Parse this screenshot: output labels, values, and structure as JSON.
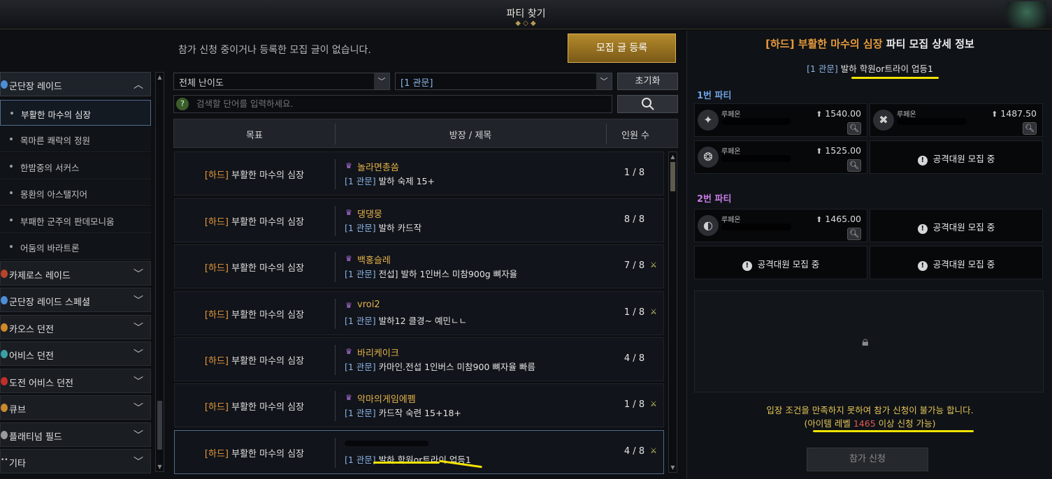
{
  "window": {
    "title": "파티 찾기"
  },
  "top": {
    "notice": "참가 신청 중이거나 등록한 모집 글이 없습니다.",
    "register_button": "모집 글 등록"
  },
  "sidebar": {
    "raid_group": "군단장 레이드",
    "raid_items": [
      "부활한 마수의 심장",
      "목마른 쾌락의 정원",
      "한밤중의 서커스",
      "몽환의 아스탤지어",
      "부패한 군주의 판데모니움",
      "어둠의 바라트론"
    ],
    "categories": [
      "카제로스 레이드",
      "군단장 레이드 스페셜",
      "카오스 던전",
      "어비스 던전",
      "도전 어비스 던전",
      "큐브",
      "플래티넘 필드",
      "기타"
    ]
  },
  "filters": {
    "difficulty": "전체 난이도",
    "gate": "[1 관문]",
    "reset_button": "초기화",
    "search_placeholder": "검색할 단어를 입력하세요.",
    "help_glyph": "?"
  },
  "table": {
    "headers": {
      "goal": "목표",
      "leader_title": "방장 / 제목",
      "count": "인원 수"
    },
    "goal_tag": "[하드]",
    "goal_name": "부활한 마수의 심장",
    "gate_tag": "[1 관문]",
    "rows": [
      {
        "leader": "놀라면총쏨",
        "subject": " 발하 숙제 15+",
        "count": "1 / 8",
        "sword": false
      },
      {
        "leader": "댕댕뭉",
        "subject": " 발하 카드작",
        "count": "8 / 8",
        "sword": false
      },
      {
        "leader": "백홍슬레",
        "subject": " 전섭] 발하 1인버스 미참900g 뼈자율",
        "count": "7 / 8",
        "sword": true
      },
      {
        "leader": "vroi2",
        "subject": " 발하12 클경~ 예민ㄴㄴ",
        "count": "1 / 8",
        "sword": true
      },
      {
        "leader": "바리케이크",
        "subject": " 카마인.전섭 1인버스 미참900 뼈자율 빠름",
        "count": "4 / 8",
        "sword": false
      },
      {
        "leader": "악마의게임에펨",
        "subject": " 카드작 숙련 15+18+",
        "count": "1 / 8",
        "sword": true
      },
      {
        "leader": "",
        "subject": " 발하 학원or트라이 업등1",
        "count": "4 / 8",
        "sword": true
      }
    ]
  },
  "detail": {
    "title_tag": "[하드]",
    "title_name": "부활한 마수의 심장",
    "title_suffix": "파티 모집 상세 정보",
    "subtitle_gate": "[1 관문]",
    "subtitle": " 발하 학원or트라이 업등1",
    "party1_label": "1번 파티",
    "party2_label": "2번 파티",
    "members": [
      {
        "name": "루페온",
        "ilvl": "1540.00"
      },
      {
        "name": "루페온",
        "ilvl": "1487.50"
      },
      {
        "name": "루페온",
        "ilvl": "1525.00"
      },
      {
        "name": "루페온",
        "ilvl": "1465.00"
      }
    ],
    "recruiting": "공격대원 모집 중",
    "warning_line1": "입장 조건을 만족하지 못하여 참가 신청이 불가능 합니다.",
    "warning_prefix": "(아이템 레벨 ",
    "warning_level": "1465",
    "warning_suffix": " 이상 신청 가능)",
    "apply_button": "참가 신청"
  }
}
